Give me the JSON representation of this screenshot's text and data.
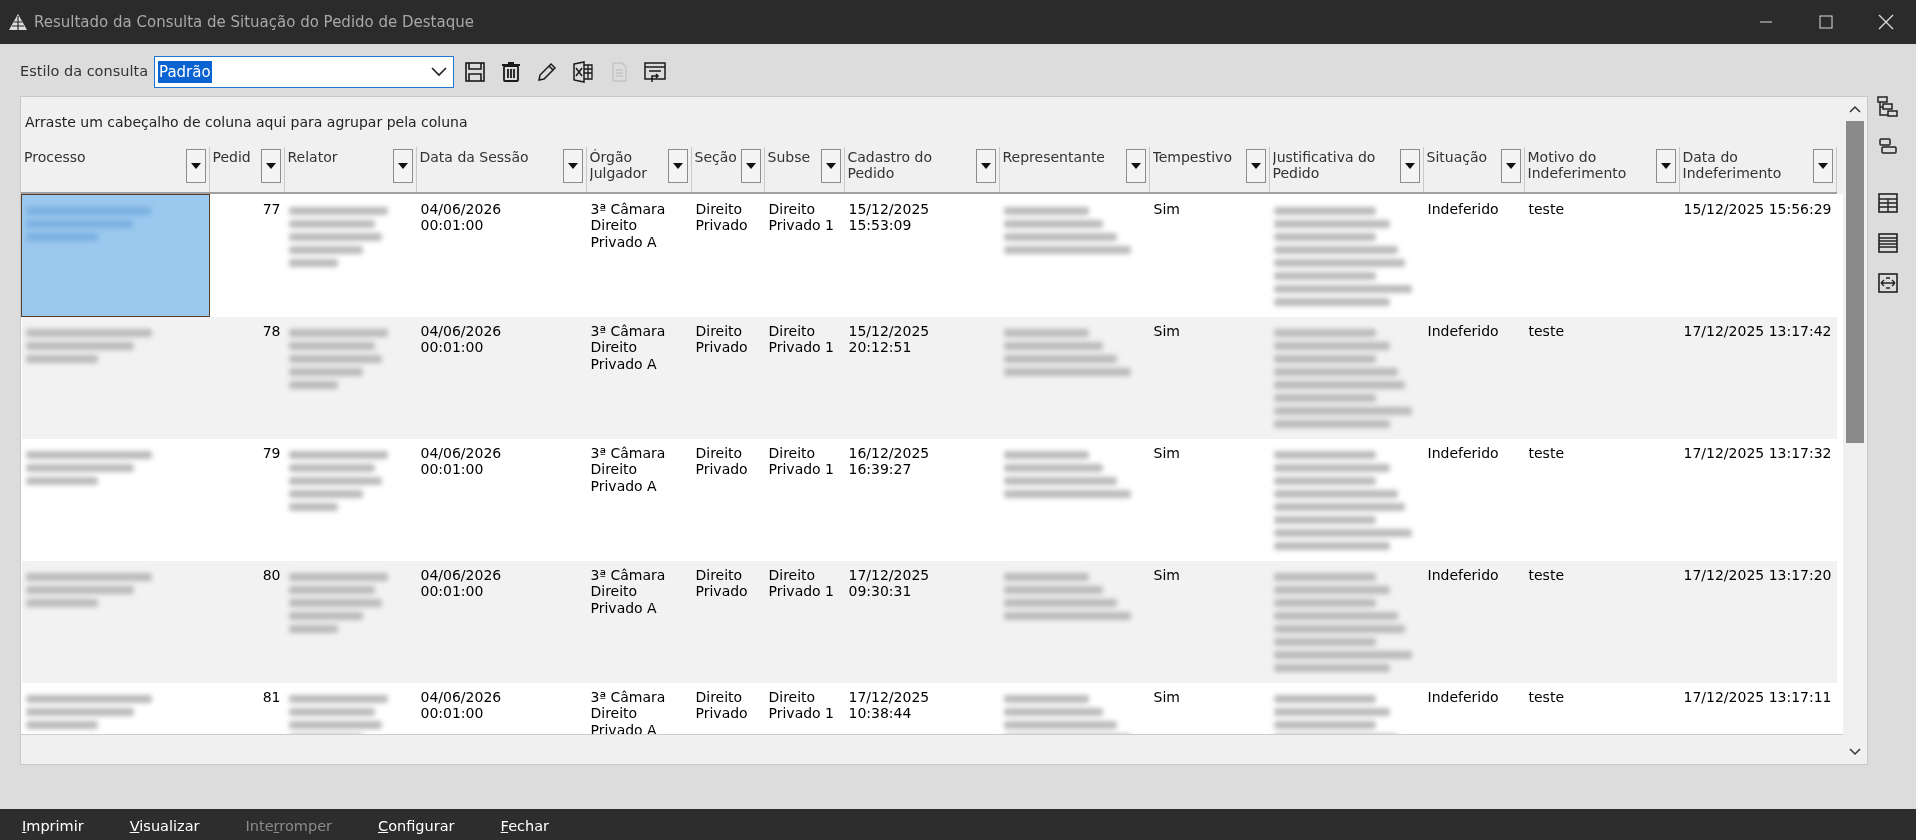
{
  "window": {
    "title": "Resultado da Consulta de Situação do Pedido de Destaque"
  },
  "toolbar": {
    "label": "Estilo da consulta",
    "style_value": "Padrão",
    "buttons": [
      {
        "kind": "save",
        "disabled": false
      },
      {
        "kind": "delete",
        "disabled": false
      },
      {
        "kind": "edit",
        "disabled": false
      },
      {
        "kind": "excel",
        "disabled": false
      },
      {
        "kind": "document",
        "disabled": true
      },
      {
        "kind": "export",
        "disabled": false
      }
    ]
  },
  "grid": {
    "group_hint": "Arraste um cabeçalho de coluna aqui para agrupar pela coluna",
    "columns": [
      {
        "label": "Processo",
        "blurred": true
      },
      {
        "label": "Pedid",
        "blurred": false
      },
      {
        "label": "Relator",
        "blurred": true
      },
      {
        "label": "Data da Sessão",
        "blurred": false
      },
      {
        "label": "Órgão Julgador",
        "blurred": false
      },
      {
        "label": "Seção",
        "blurred": false
      },
      {
        "label": "Subse",
        "blurred": false
      },
      {
        "label": "Cadastro do Pedido",
        "blurred": false
      },
      {
        "label": "Representante",
        "blurred": true
      },
      {
        "label": "Tempestivo",
        "blurred": false
      },
      {
        "label": "Justificativa do Pedido",
        "blurred": true
      },
      {
        "label": "Situação",
        "blurred": false
      },
      {
        "label": "Motivo do Indeferimento",
        "blurred": false
      },
      {
        "label": "Data do Indeferimento",
        "blurred": false
      }
    ],
    "rows": [
      {
        "selected": true,
        "cells": [
          "",
          "77",
          "",
          "04/06/2026\n00:01:00",
          "3ª Câmara\nDireito\nPrivado A",
          "Direito\nPrivado",
          "Direito\nPrivado 1",
          "15/12/2025\n15:53:09",
          "",
          "Sim",
          "",
          "Indeferido",
          "teste",
          "15/12/2025 15:56:29"
        ]
      },
      {
        "selected": false,
        "cells": [
          "",
          "78",
          "",
          "04/06/2026\n00:01:00",
          "3ª Câmara\nDireito\nPrivado A",
          "Direito\nPrivado",
          "Direito\nPrivado 1",
          "15/12/2025\n20:12:51",
          "",
          "Sim",
          "",
          "Indeferido",
          "teste",
          "17/12/2025 13:17:42"
        ]
      },
      {
        "selected": false,
        "cells": [
          "",
          "79",
          "",
          "04/06/2026\n00:01:00",
          "3ª Câmara\nDireito\nPrivado A",
          "Direito\nPrivado",
          "Direito\nPrivado 1",
          "16/12/2025\n16:39:27",
          "",
          "Sim",
          "",
          "Indeferido",
          "teste",
          "17/12/2025 13:17:32"
        ]
      },
      {
        "selected": false,
        "cells": [
          "",
          "80",
          "",
          "04/06/2026\n00:01:00",
          "3ª Câmara\nDireito\nPrivado A",
          "Direito\nPrivado",
          "Direito\nPrivado 1",
          "17/12/2025\n09:30:31",
          "",
          "Sim",
          "",
          "Indeferido",
          "teste",
          "17/12/2025 13:17:20"
        ]
      },
      {
        "selected": false,
        "cells": [
          "",
          "81",
          "",
          "04/06/2026\n00:01:00",
          "3ª Câmara\nDireito\nPrivado A",
          "Direito\nPrivado",
          "Direito\nPrivado 1",
          "17/12/2025\n10:38:44",
          "",
          "Sim",
          "",
          "Indeferido",
          "teste",
          "17/12/2025 13:17:11"
        ]
      }
    ]
  },
  "side_tools": [
    {
      "kind": "tree"
    },
    {
      "kind": "group"
    },
    {
      "kind": "columns"
    },
    {
      "kind": "rows"
    },
    {
      "kind": "fit"
    }
  ],
  "footer": {
    "buttons": [
      {
        "key": "I",
        "after": "mprimir",
        "disabled": false
      },
      {
        "key": "V",
        "after": "isualizar",
        "disabled": false
      },
      {
        "before": "Inte",
        "key": "r",
        "after": "romper",
        "disabled": true
      },
      {
        "key": "C",
        "after": "onfigurar",
        "disabled": false
      },
      {
        "key": "F",
        "after": "echar",
        "disabled": false
      }
    ]
  }
}
